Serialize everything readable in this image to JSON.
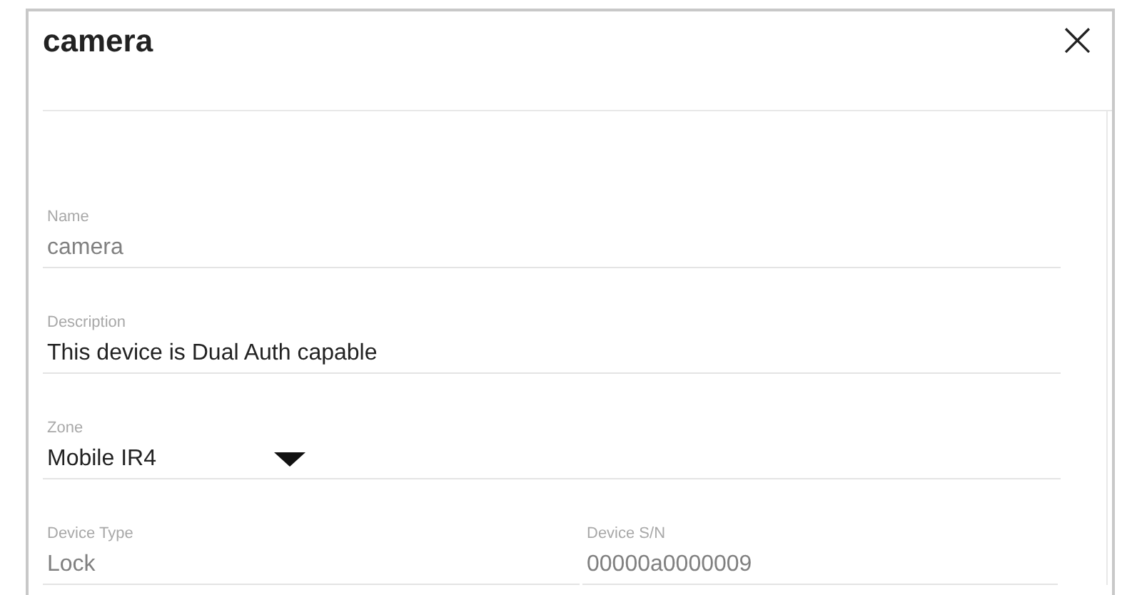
{
  "dialog": {
    "title": "camera",
    "close": "×"
  },
  "fields": [
    {
      "kind": "text",
      "label": "Name",
      "value": "camera",
      "disabled": true
    },
    {
      "kind": "text",
      "label": "Description",
      "value": "This device is Dual Auth capable",
      "disabled": false
    },
    {
      "kind": "select",
      "label": "Zone",
      "value": "Mobile IR4",
      "disabled": false
    },
    {
      "kind": "pair",
      "items": [
        {
          "label": "Device Type",
          "value": "Lock",
          "disabled": true
        },
        {
          "label": "Device S/N",
          "value": "00000a0000009",
          "disabled": true
        }
      ]
    }
  ]
}
